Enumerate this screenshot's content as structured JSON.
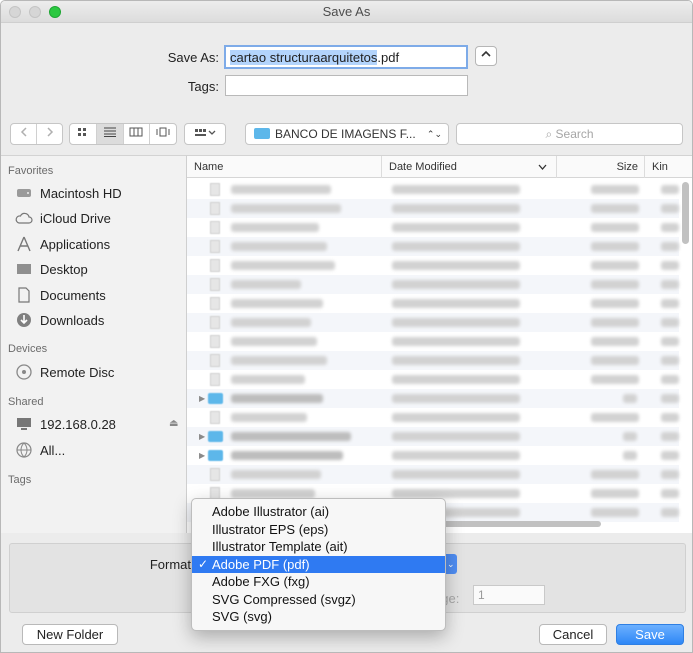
{
  "window": {
    "title": "Save As"
  },
  "save_as": {
    "label": "Save As:",
    "filename": "cartao structuraarquitetos.pdf",
    "filename_selected": "cartao structuraarquitetos",
    "filename_ext": ".pdf",
    "tags_label": "Tags:",
    "tags_value": ""
  },
  "toolbar": {
    "location": "BANCO DE IMAGENS F...",
    "search_placeholder": "Search"
  },
  "sidebar": {
    "sections": [
      {
        "title": "Favorites",
        "items": [
          {
            "label": "Macintosh HD",
            "icon": "hard-drive-icon"
          },
          {
            "label": "iCloud Drive",
            "icon": "cloud-icon"
          },
          {
            "label": "Applications",
            "icon": "applications-icon"
          },
          {
            "label": "Desktop",
            "icon": "desktop-icon"
          },
          {
            "label": "Documents",
            "icon": "document-icon"
          },
          {
            "label": "Downloads",
            "icon": "download-icon"
          }
        ]
      },
      {
        "title": "Devices",
        "items": [
          {
            "label": "Remote Disc",
            "icon": "disc-icon"
          }
        ]
      },
      {
        "title": "Shared",
        "items": [
          {
            "label": "192.168.0.28",
            "icon": "monitor-icon"
          },
          {
            "label": "All...",
            "icon": "network-icon"
          }
        ]
      },
      {
        "title": "Tags",
        "items": []
      }
    ]
  },
  "file_list": {
    "columns": {
      "name": "Name",
      "date": "Date Modified",
      "size": "Size",
      "kind": "Kin"
    }
  },
  "format": {
    "label": "Format",
    "range_label": "nge:",
    "range_value": "1",
    "options": [
      "Adobe Illustrator (ai)",
      "Illustrator EPS (eps)",
      "Illustrator Template (ait)",
      "Adobe PDF (pdf)",
      "Adobe FXG (fxg)",
      "SVG Compressed (svgz)",
      "SVG (svg)"
    ],
    "selected_index": 3,
    "check_mark": "✓"
  },
  "buttons": {
    "new_folder": "New Folder",
    "cancel": "Cancel",
    "save": "Save"
  },
  "colors": {
    "accent": "#2f7af2",
    "folder": "#5db7ea"
  }
}
